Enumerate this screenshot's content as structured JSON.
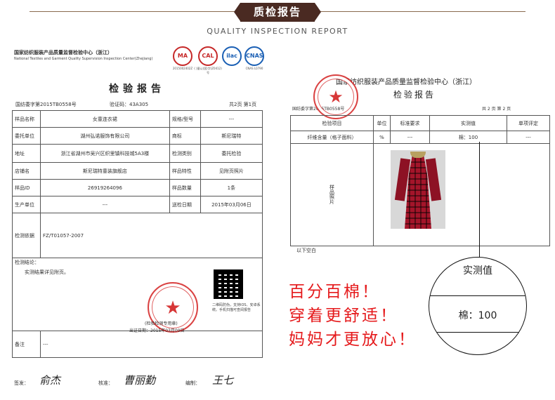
{
  "header": {
    "title": "质检报告",
    "subtitle": "QUALITY INSPECTION REPORT"
  },
  "left_report": {
    "center_name": "国家纺织服装产品质量监督检验中心（浙江）",
    "center_name_en": "National Textiles and Garment Quality Supervision Inspection Center(Zhejiang)",
    "cert_marks": [
      {
        "label": "MA",
        "caption": "2015002402Z"
      },
      {
        "label": "CAL",
        "caption": "( )量认(国)字(Z0412)号"
      },
      {
        "label": "ilac",
        "caption": ""
      },
      {
        "label": "CNAS",
        "caption": "CNAS L0790"
      }
    ],
    "title": "检验报告",
    "report_no": "国纺委字第2015TB0558号",
    "verify_code": "验证码：43A305",
    "page": "共2页 第1页",
    "rows": {
      "sample_name_label": "样品名称",
      "sample_name": "女童连衣裙",
      "spec_label": "规格/型号",
      "spec": "---",
      "client_label": "委托单位",
      "client": "湖州弘诺服饰有限公司",
      "trademark_label": "商标",
      "trademark": "斯尼瑞特",
      "address_label": "地址",
      "address": "浙江省湖州市吴兴区织里镇科技城5A3楼",
      "test_type_label": "检测类别",
      "test_type": "委托检验",
      "shop_label": "店铺名",
      "shop": "斯尼瑞特童装旗舰店",
      "feature_label": "样品特性",
      "feature": "见附页照片",
      "sample_id_label": "样品ID",
      "sample_id": "26919264096",
      "quantity_label": "样品数量",
      "quantity": "1条",
      "producer_label": "生产单位",
      "producer": "---",
      "date_label": "送检日期",
      "date": "2015年03月06日",
      "basis_label": "检测依据",
      "basis": "FZ/T01057-2007",
      "conclusion_label": "检测结论：",
      "conclusion": "实测结果详见附页。",
      "seal_caption": "(检验检测专用章)",
      "issue_date": "出证日期：2015年03月09日",
      "qr_note": "二维码防伪，支持IOS、安卓系统。手机扫描可查阅报告",
      "remark_label": "备注",
      "remark": "---"
    },
    "signatures": {
      "sign_label": "签发：",
      "sign_value": "俞杰",
      "approve_label": "核准：",
      "approve_value": "曹丽勤",
      "compile_label": "编制：",
      "compile_value": "王七"
    }
  },
  "right_report": {
    "center_name": "国家纺织服装产品质量监督检验中心（浙江）",
    "title": "检验报告",
    "report_no": "国纺委字第2015TB0558号",
    "page": "共 2 页 第 2 页",
    "headers": [
      "检验项目",
      "单位",
      "标准要求",
      "实测值",
      "单项评定"
    ],
    "row": [
      "纤维含量（格子面料）",
      "%",
      "---",
      "棉：100",
      "---"
    ],
    "photo_label": "样品照片",
    "below": "以下空白"
  },
  "promo": [
    "百分百棉！",
    "穿着更舒适！",
    "妈妈才更放心！"
  ],
  "magnifier": {
    "label": "实测值",
    "value": "棉：100"
  }
}
